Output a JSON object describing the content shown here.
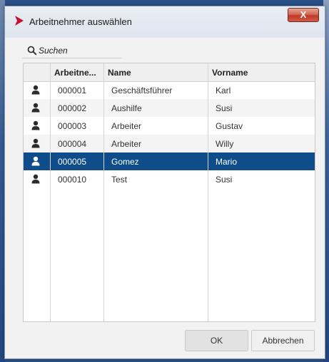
{
  "window": {
    "title": "Arbeitnehmer auswählen",
    "close_label": "X"
  },
  "search": {
    "placeholder": "Suchen"
  },
  "table": {
    "columns": [
      "Arbeitne...",
      "Name",
      "Vorname"
    ],
    "rows": [
      {
        "id": "000001",
        "name": "Geschäftsführer",
        "first": "Karl"
      },
      {
        "id": "000002",
        "name": "Aushilfe",
        "first": "Susi"
      },
      {
        "id": "000003",
        "name": "Arbeiter",
        "first": "Gustav"
      },
      {
        "id": "000004",
        "name": "Arbeiter",
        "first": "Willy"
      },
      {
        "id": "000005",
        "name": "Gomez",
        "first": "Mario"
      },
      {
        "id": "000010",
        "name": "Test",
        "first": "Susi"
      }
    ],
    "selected_index": 4
  },
  "buttons": {
    "ok": "OK",
    "cancel": "Abbrechen"
  },
  "colors": {
    "accent": "#c8102e",
    "selection": "#0f4c8a"
  },
  "icons": {
    "app": "chevron-right-icon",
    "search": "search-icon",
    "row": "user-icon"
  }
}
